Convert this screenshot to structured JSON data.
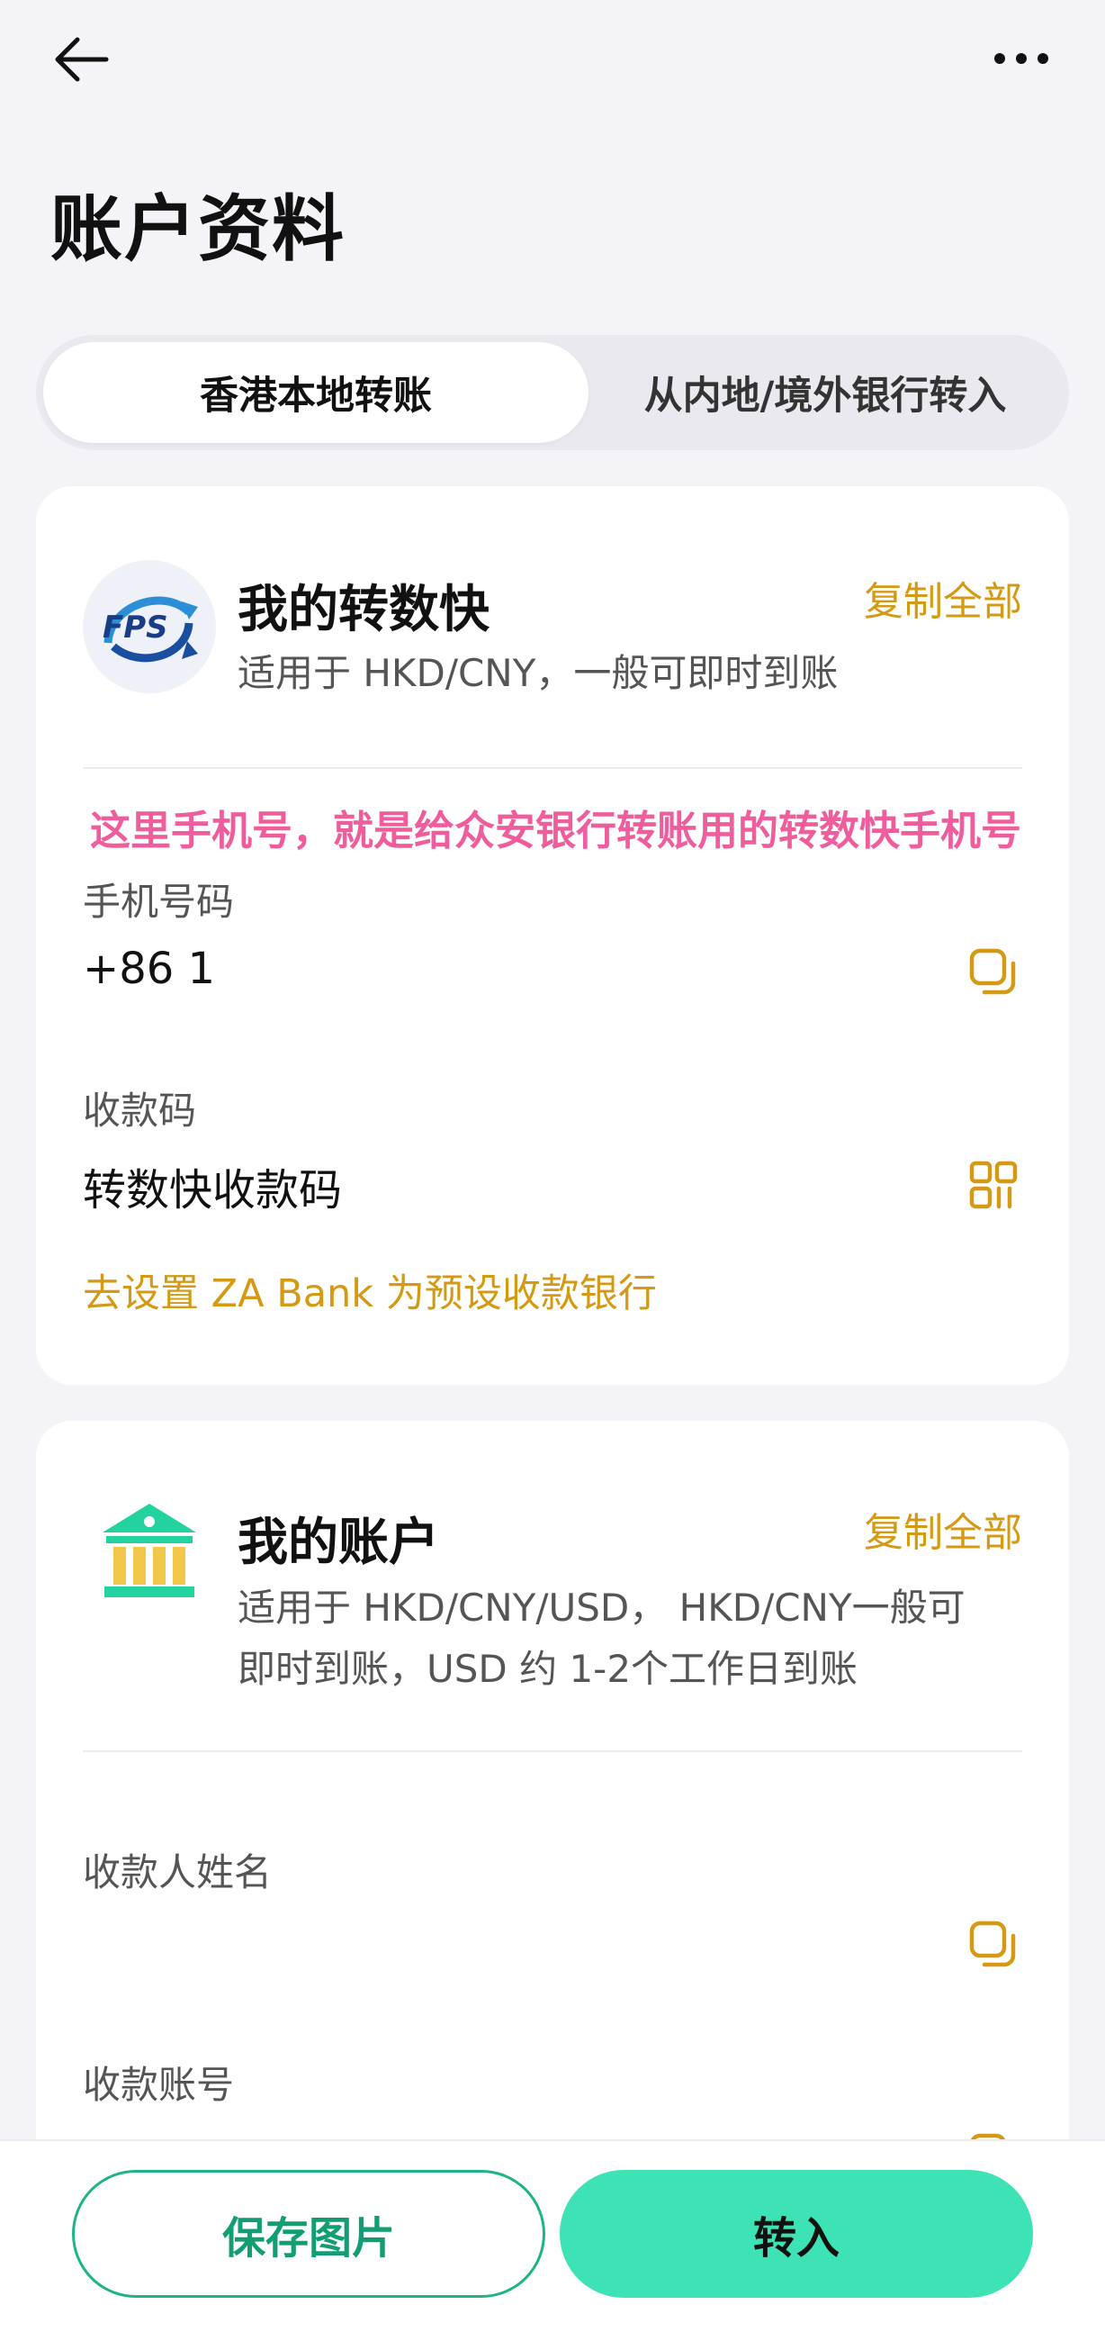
{
  "header": {
    "back_icon": "arrow-left-icon",
    "more_icon": "more-dots-icon",
    "title": "账户资料"
  },
  "tabs": [
    {
      "label": "香港本地转账",
      "active": true
    },
    {
      "label": "从内地/境外银行转入",
      "active": false
    }
  ],
  "fps_card": {
    "logo_text": "FPS",
    "title": "我的转数快",
    "copy_all": "复制全部",
    "description": "适用于 HKD/CNY，一般可即时到账",
    "annotation": "这里手机号，就是给众安银行转账用的转数快手机号",
    "phone_label": "手机号码",
    "phone_value": "+86 1",
    "qr_label": "收款码",
    "qr_value": "转数快收款码",
    "set_default_link": "去设置 ZA Bank 为预设收款银行"
  },
  "account_card": {
    "title": "我的账户",
    "copy_all": "复制全部",
    "description_line1": "适用于 HKD/CNY/USD， HKD/CNY一般可",
    "description_line2": "即时到账，USD 约 1-2个工作日到账",
    "payee_name_label": "收款人姓名",
    "payee_name_value": "",
    "account_no_label": "收款账号"
  },
  "bottom": {
    "save_label": "保存图片",
    "transfer_label": "转入"
  },
  "colors": {
    "accent_gold": "#d49a14",
    "brand_green": "#3de3b4",
    "annotation_pink": "#ef5d9c",
    "bank_icon_green": "#22d39f",
    "bank_icon_yellow": "#f2c84b"
  }
}
